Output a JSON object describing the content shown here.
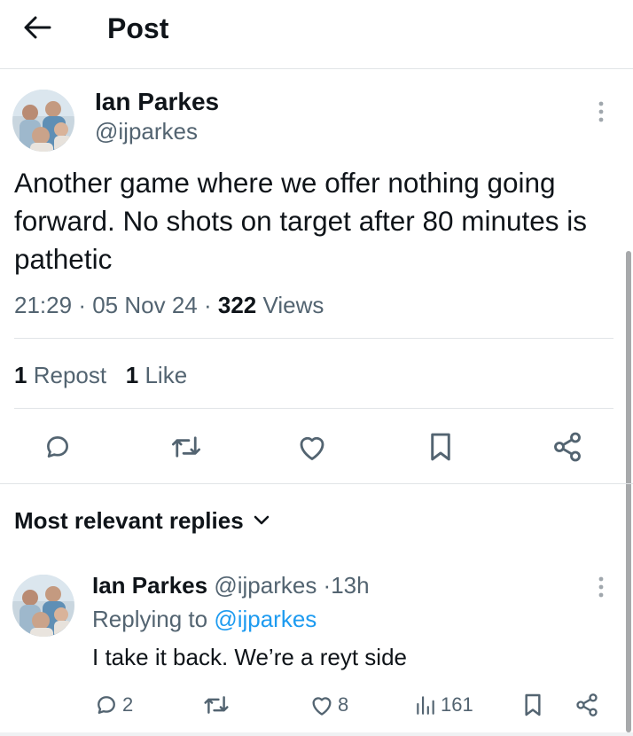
{
  "header": {
    "title": "Post",
    "back_icon": "arrow-left-icon"
  },
  "tweet": {
    "author_name": "Ian Parkes",
    "author_handle": "@ijparkes",
    "text": "Another game where we offer nothing going forward. No shots on target after 80 minutes is pathetic",
    "time": "21:29",
    "date": "05 Nov 24",
    "views_count": "322",
    "views_label": "Views",
    "separator": "·",
    "reposts_count": "1",
    "reposts_label": "Repost",
    "likes_count": "1",
    "likes_label": "Like",
    "actions": [
      "reply-icon",
      "repost-icon",
      "like-icon",
      "bookmark-icon",
      "share-icon"
    ]
  },
  "replies": {
    "sort_label": "Most relevant replies",
    "items": [
      {
        "author_name": "Ian Parkes",
        "author_handle": "@ijparkes",
        "separator": "·",
        "time_ago": "13h",
        "replying_to_prefix": "Replying to",
        "replying_to_handle": "@ijparkes",
        "text": "I take it back. We’re a reyt side",
        "reply_count": "2",
        "repost_count": "",
        "like_count": "8",
        "views_count": "161"
      }
    ]
  },
  "colors": {
    "text_primary": "#0f1419",
    "text_secondary": "#536471",
    "link": "#1d9bf0",
    "divider": "#e1e4e7"
  }
}
